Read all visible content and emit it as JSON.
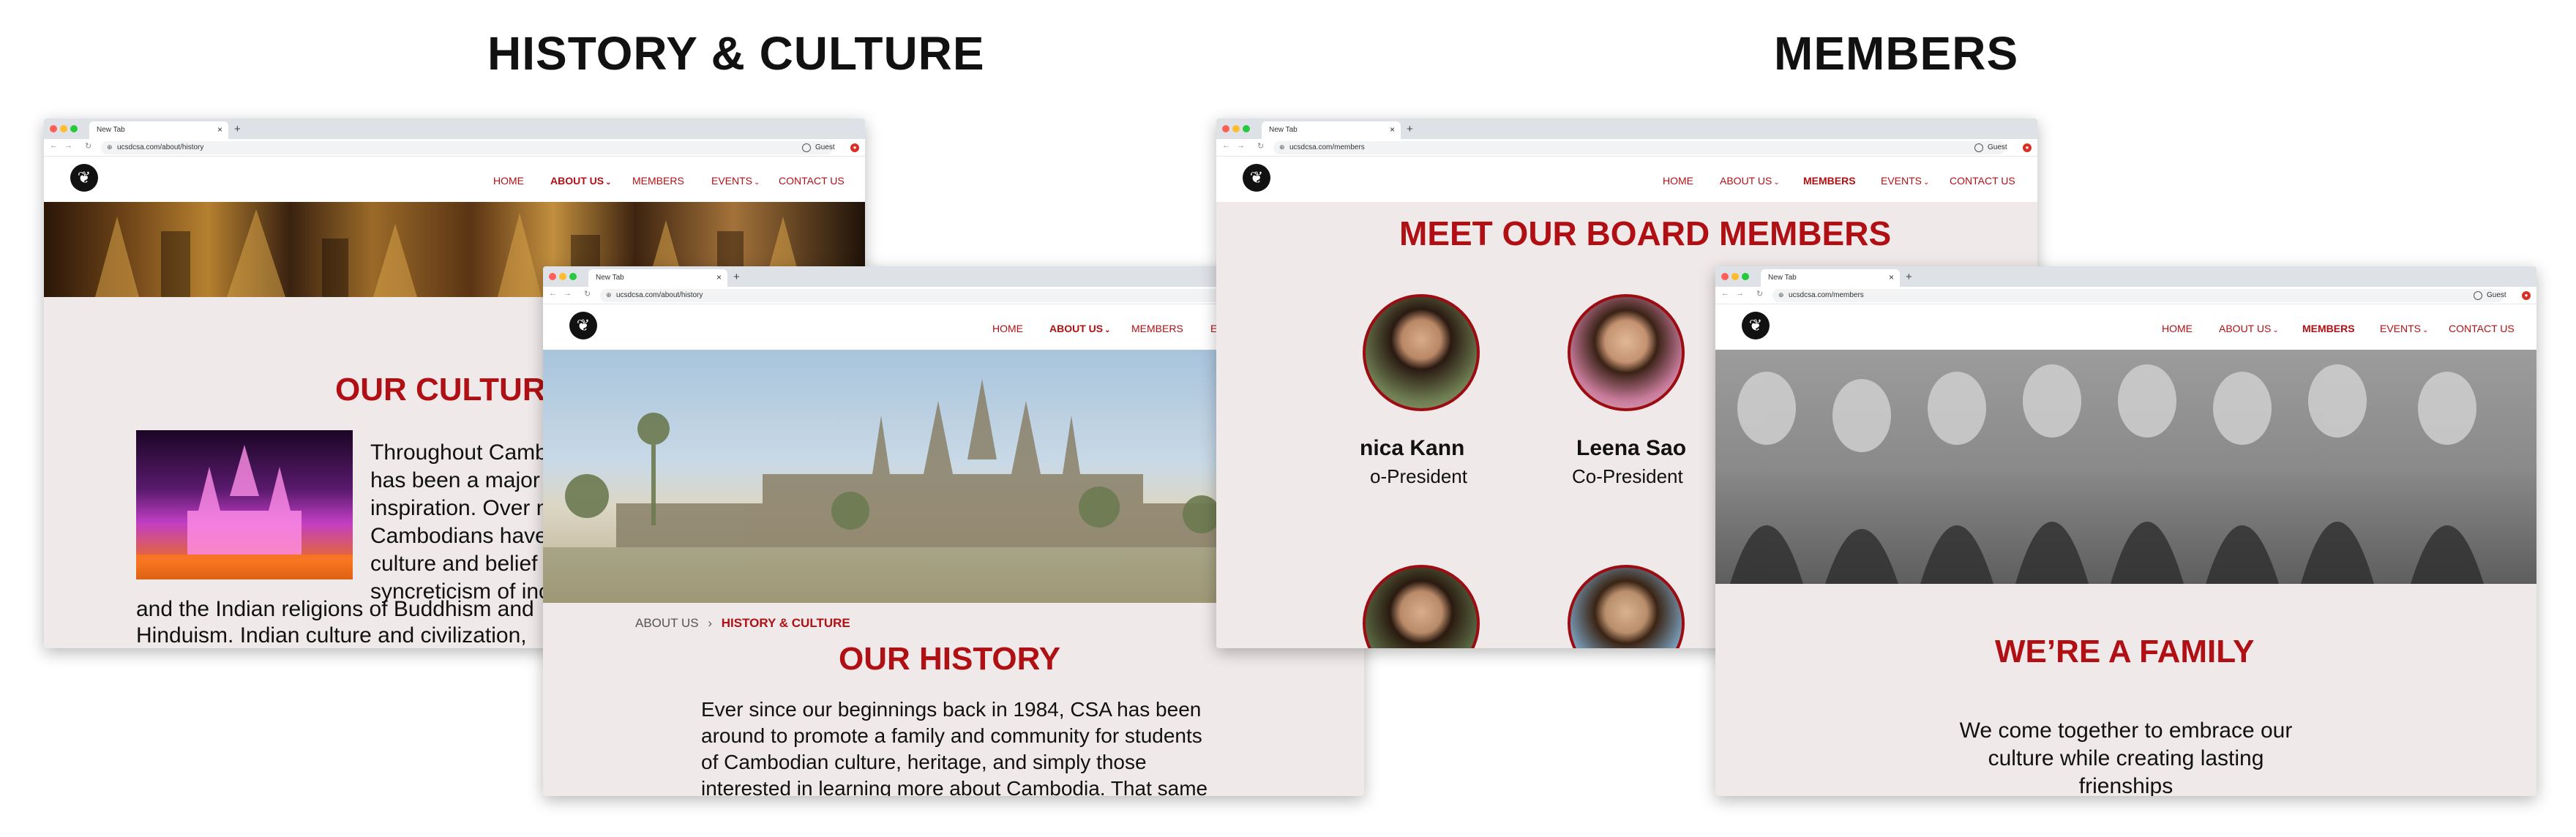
{
  "titles": {
    "left": "HISTORY & CULTURE",
    "right": "MEMBERS"
  },
  "browser": {
    "tab_title": "New Tab",
    "guest_label": "Guest",
    "close_symbol": "×",
    "new_tab_symbol": "+"
  },
  "urls": {
    "culture": "ucsdcsa.com/about/history",
    "history": "ucsdcsa.com/about/history",
    "board": "ucsdcsa.com/members",
    "family": "ucsdcsa.com/members"
  },
  "nav": {
    "home": "HOME",
    "about": "ABOUT US",
    "members": "MEMBERS",
    "events": "EVENTS",
    "contact": "CONTACT US"
  },
  "culture": {
    "heading": "OUR CULTURE",
    "lines": [
      "Throughout Cambo",
      "has been a major s",
      "inspiration. Over m",
      "Cambodians have",
      "culture and belief s",
      "syncreticism of inc",
      "and the Indian religions of Buddhism and",
      "Hinduism. Indian culture and civilization,"
    ]
  },
  "history": {
    "breadcrumb_parent": "ABOUT US",
    "breadcrumb_sep": "›",
    "breadcrumb_current": "HISTORY & CULTURE",
    "heading": "OUR HISTORY",
    "lines": [
      "Ever since our beginnings back in 1984, CSA has been",
      "around to promote a family and community for students",
      "of Cambodian culture, heritage, and simply those",
      "interested in learning more about Cambodia. That same"
    ]
  },
  "board": {
    "heading": "MEET OUR BOARD MEMBERS",
    "members": [
      {
        "name": "nica Kann",
        "role": "o-President"
      },
      {
        "name": "Leena Sao",
        "role": "Co-President"
      }
    ]
  },
  "family": {
    "heading": "WE’RE A FAMILY",
    "lines": [
      "We come together to embrace our",
      "culture while creating lasting",
      "frienships"
    ]
  },
  "colors": {
    "brand_red": "#b01014",
    "page_bg": "#efe9e9",
    "chrome": "#dee1e6"
  },
  "icons": [
    "logo-icon",
    "lock-icon",
    "back-icon",
    "forward-icon",
    "reload-icon",
    "profile-icon",
    "extension-icon",
    "chevron-down-icon"
  ]
}
